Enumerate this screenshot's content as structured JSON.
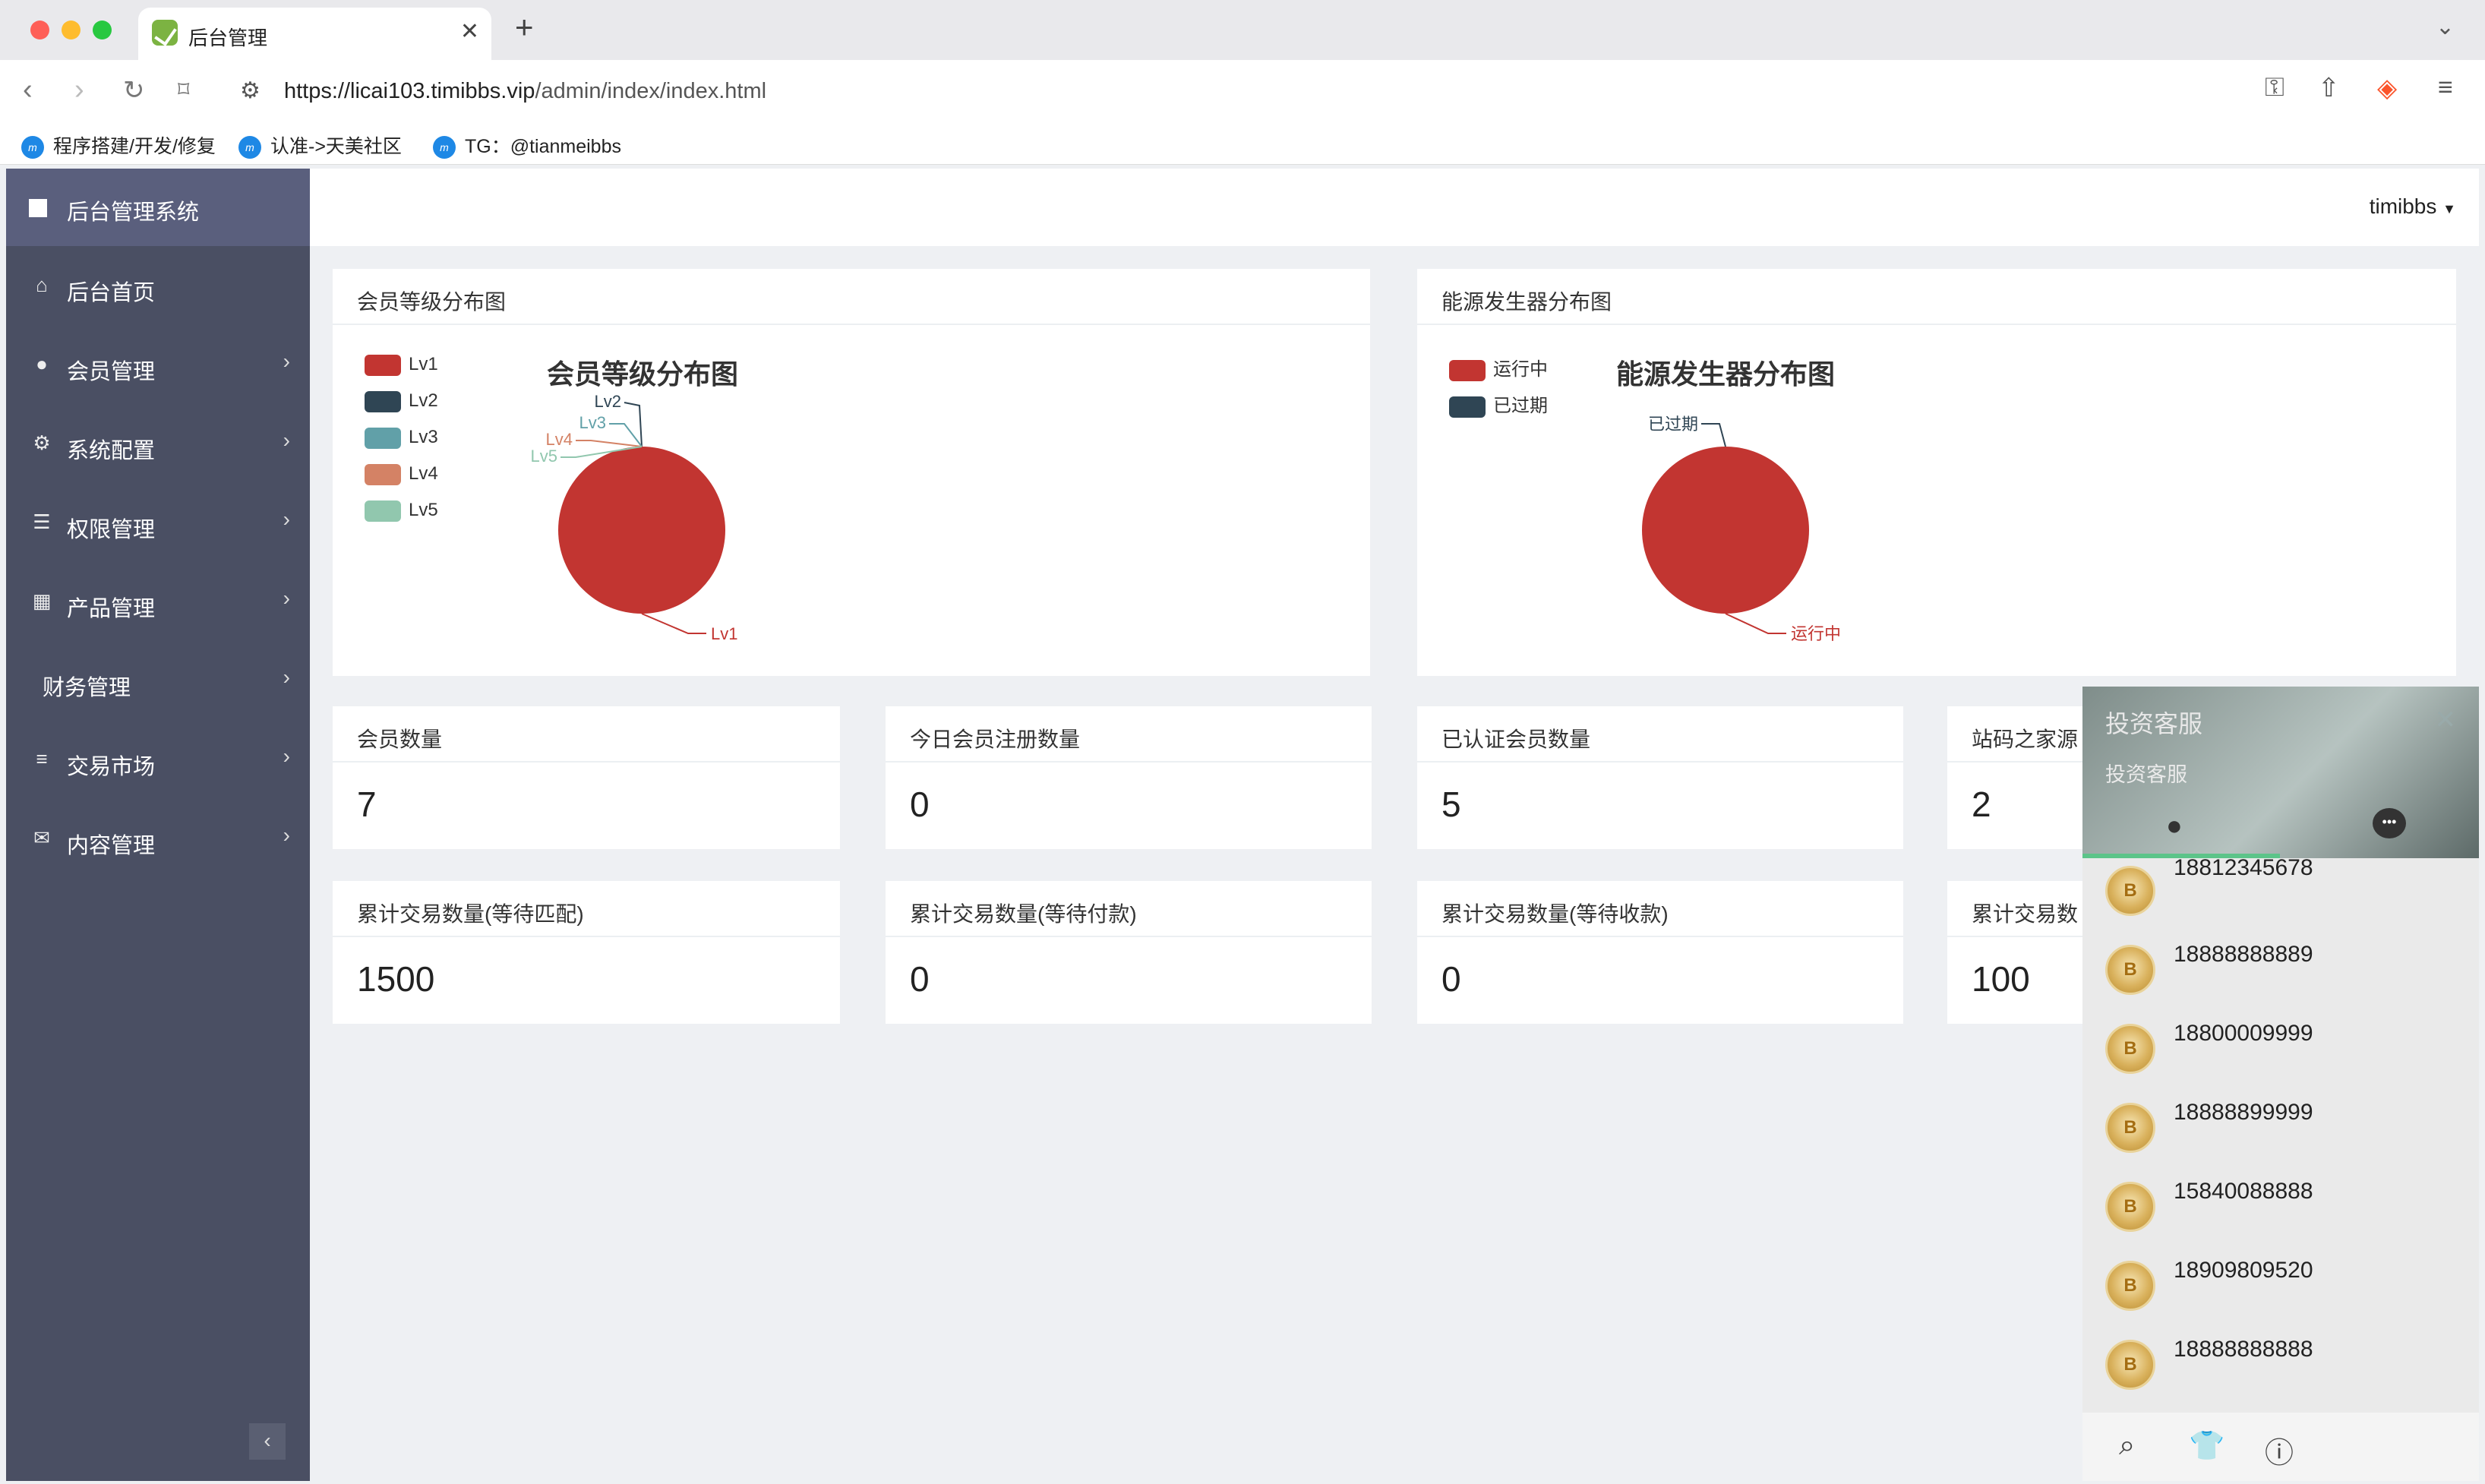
{
  "browser": {
    "tab_title": "后台管理",
    "url_host": "https://licai103.timibbs.vip",
    "url_path": "/admin/index/index.html",
    "bookmarks": [
      "程序搭建/开发/修复",
      "认准->天美社区",
      "TG：@tianmeibbs"
    ]
  },
  "sidebar": {
    "brand": "后台管理系统",
    "items": [
      {
        "label": "后台首页"
      },
      {
        "label": "会员管理"
      },
      {
        "label": "系统配置"
      },
      {
        "label": "权限管理"
      },
      {
        "label": "产品管理"
      },
      {
        "label": "财务管理"
      },
      {
        "label": "交易市场"
      },
      {
        "label": "内容管理"
      }
    ]
  },
  "topnav": {
    "user": "timibbs"
  },
  "charts": {
    "member_level": {
      "panel_title": "会员等级分布图",
      "chart_title": "会员等级分布图",
      "legend": [
        "Lv1",
        "Lv2",
        "Lv3",
        "Lv4",
        "Lv5"
      ],
      "colors": [
        "#c23531",
        "#2f4554",
        "#61a0a8",
        "#d48265",
        "#91c7ae"
      ]
    },
    "energy": {
      "panel_title": "能源发生器分布图",
      "chart_title": "能源发生器分布图",
      "legend": [
        "运行中",
        "已过期"
      ],
      "colors": [
        "#c23531",
        "#2f4554"
      ]
    }
  },
  "chart_data": [
    {
      "type": "pie",
      "title": "会员等级分布图",
      "categories": [
        "Lv1",
        "Lv2",
        "Lv3",
        "Lv4",
        "Lv5"
      ],
      "values": [
        7,
        0,
        0,
        0,
        0
      ],
      "legend": "top-left"
    },
    {
      "type": "pie",
      "title": "能源发生器分布图",
      "categories": [
        "运行中",
        "已过期"
      ],
      "values": [
        2,
        0
      ],
      "legend": "top-left"
    }
  ],
  "stats": [
    {
      "label": "会员数量",
      "value": "7"
    },
    {
      "label": "今日会员注册数量",
      "value": "0"
    },
    {
      "label": "已认证会员数量",
      "value": "5"
    },
    {
      "label": "站码之家源",
      "value": "2"
    },
    {
      "label": "累计交易数量(等待匹配)",
      "value": "1500"
    },
    {
      "label": "累计交易数量(等待付款)",
      "value": "0"
    },
    {
      "label": "累计交易数量(等待收款)",
      "value": "0"
    },
    {
      "label": "累计交易数",
      "value": "100"
    }
  ],
  "chat": {
    "title": "投资客服",
    "subtitle": "投资客服",
    "contacts": [
      "18812345678",
      "18888888889",
      "18800009999",
      "18888899999",
      "15840088888",
      "18909809520",
      "18888888888"
    ]
  }
}
